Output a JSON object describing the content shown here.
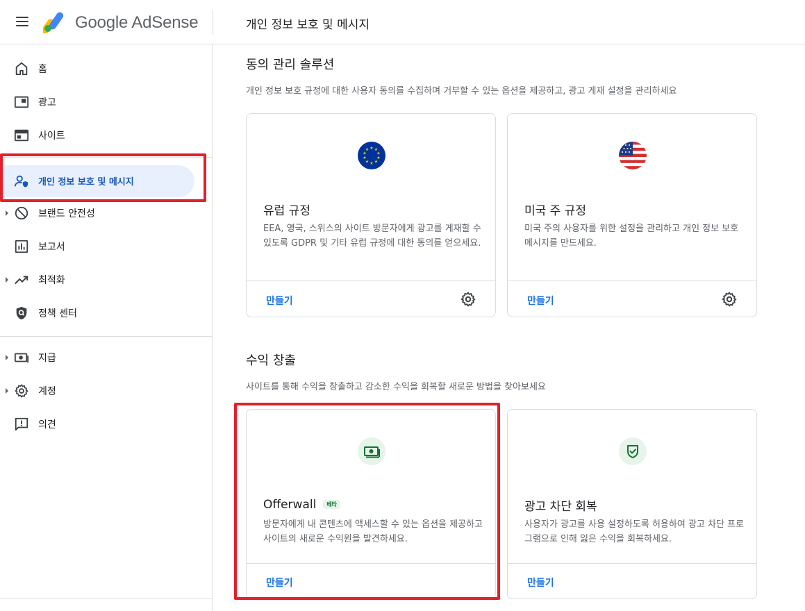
{
  "app": {
    "title": "Google AdSense",
    "page_title": "개인 정보 보호 및 메시지"
  },
  "sidebar": {
    "items": [
      {
        "label": "홈",
        "icon": "home-icon"
      },
      {
        "label": "광고",
        "icon": "ads-icon"
      },
      {
        "label": "사이트",
        "icon": "sites-icon"
      },
      {
        "label": "개인 정보 보호 및 메시지",
        "icon": "privacy-messaging-icon",
        "active": true
      },
      {
        "label": "브랜드 안전성",
        "icon": "block-icon",
        "expandable": true
      },
      {
        "label": "보고서",
        "icon": "reports-icon"
      },
      {
        "label": "최적화",
        "icon": "trending-icon",
        "expandable": true
      },
      {
        "label": "정책 센터",
        "icon": "policy-shield-icon"
      },
      {
        "label": "지급",
        "icon": "payments-icon",
        "expandable": true
      },
      {
        "label": "계정",
        "icon": "gear-icon",
        "expandable": true
      },
      {
        "label": "의견",
        "icon": "feedback-icon"
      }
    ]
  },
  "consent": {
    "title": "동의 관리 솔루션",
    "description": "개인 정보 보호 규정에 대한 사용자 동의를 수집하며 거부할 수 있는 옵션을 제공하고, 광고 게재 설정을 관리하세요",
    "cards": [
      {
        "title": "유럽 규정",
        "description": "EEA, 영국, 스위스의 사이트 방문자에게 광고를 게재할 수 있도록 GDPR 및 기타 유럽 규정에 대한 동의를 얻으세요.",
        "create_label": "만들기",
        "icon": "eu-flag-icon"
      },
      {
        "title": "미국 주 규정",
        "description": "미국 주의 사용자를 위한 설정을 관리하고 개인 정보 보호 메시지를 만드세요.",
        "create_label": "만들기",
        "icon": "us-flag-icon"
      }
    ]
  },
  "revenue": {
    "title": "수익 창출",
    "description": "사이트를 통해 수익을 창출하고 감소한 수익을 회복할 새로운 방법을 찾아보세요",
    "cards": [
      {
        "title": "Offerwall",
        "badge": "베타",
        "description": "방문자에게 내 콘텐츠에 액세스할 수 있는 옵션을 제공하고 사이트의 새로운 수익원을 발견하세요.",
        "create_label": "만들기",
        "icon": "money-icon"
      },
      {
        "title": "광고 차단 회복",
        "description": "사용자가 광고를 사용 설정하도록 허용하여 광고 차단 프로그램으로 인해 잃은 수익을 회복하세요.",
        "create_label": "만들기",
        "icon": "shield-check-icon"
      }
    ]
  },
  "colors": {
    "accent": "#1a73e8",
    "active_bg": "#e8f0fe",
    "highlight": "#e4202a",
    "beta_bg": "#e6f4ea",
    "beta_text": "#137333"
  }
}
